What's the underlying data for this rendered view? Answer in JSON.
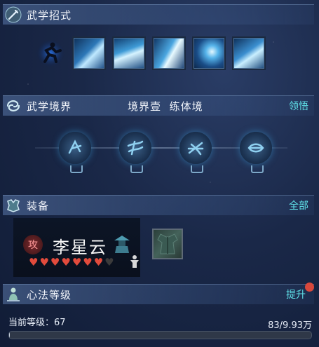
{
  "martial_skills": {
    "title": "武学招式",
    "skill_count": 5
  },
  "realm": {
    "title": "武学境界",
    "current": "境界壹",
    "stage": "练体境",
    "action": "领悟",
    "node_count": 4
  },
  "equipment": {
    "title": "装备",
    "action": "全部",
    "character": {
      "name": "李星云",
      "badge": "攻",
      "hearts_filled": 7,
      "hearts_total": 8
    }
  },
  "heart_method": {
    "title": "心法等级",
    "action": "提升",
    "level_label": "当前等级：67",
    "progress_text": "83/9.93万",
    "progress_fraction": 0.0008
  },
  "colors": {
    "accent": "#5fe0e8",
    "heart": "#e24b3c",
    "notify": "#d8483c"
  }
}
